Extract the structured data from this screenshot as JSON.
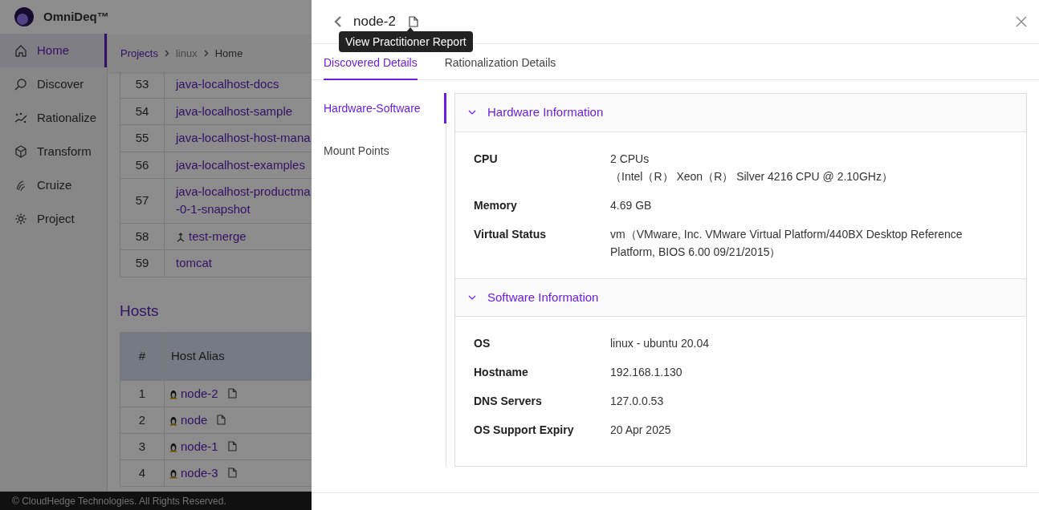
{
  "app": {
    "brand": "OmniDeq™",
    "nav": [
      {
        "label": "Home",
        "selected": true
      },
      {
        "label": "Discover",
        "selected": false
      },
      {
        "label": "Rationalize",
        "selected": false
      },
      {
        "label": "Transform",
        "selected": false
      },
      {
        "label": "Cruize",
        "selected": false
      },
      {
        "label": "Project",
        "selected": false
      }
    ],
    "breadcrumb": [
      {
        "label": "Projects",
        "kind": "link"
      },
      {
        "label": "linux",
        "kind": "muted"
      },
      {
        "label": "Home",
        "kind": "current"
      }
    ],
    "projects_table": {
      "rows": [
        {
          "number": "53",
          "name": "java-localhost-docs",
          "kind": "plain"
        },
        {
          "number": "54",
          "name": "java-localhost-sample",
          "kind": "plain"
        },
        {
          "number": "55",
          "name": "java-localhost-host-mana",
          "kind": "plain"
        },
        {
          "number": "56",
          "name": "java-localhost-examples",
          "kind": "plain"
        },
        {
          "number": "57",
          "name": "java-localhost-productma -0-1-snapshot",
          "kind": "plain"
        },
        {
          "number": "58",
          "name": "test-merge",
          "kind": "merge"
        },
        {
          "number": "59",
          "name": "tomcat",
          "kind": "plain"
        }
      ]
    },
    "hosts": {
      "heading": "Hosts",
      "columns": [
        "#",
        "Host Alias"
      ],
      "rows": [
        {
          "number": "1",
          "alias": "node-2"
        },
        {
          "number": "2",
          "alias": "node"
        },
        {
          "number": "3",
          "alias": "node-1"
        },
        {
          "number": "4",
          "alias": "node-3"
        }
      ]
    },
    "footer": "© CloudHedge Technologies. All Rights Reserved."
  },
  "drawer": {
    "title": "node-2",
    "tooltip": "View Practitioner Report",
    "tabs": [
      {
        "label": "Discovered Details",
        "selected": true
      },
      {
        "label": "Rationalization Details",
        "selected": false
      }
    ],
    "side_tabs": [
      {
        "label": "Hardware-Software",
        "selected": true
      },
      {
        "label": "Mount Points",
        "selected": false
      }
    ],
    "sections": [
      {
        "title": "Hardware Information",
        "expanded": true,
        "fields": [
          {
            "label": "CPU",
            "lines": [
              "2 CPUs",
              "（Intel（R） Xeon（R） Silver 4216 CPU @ 2.10GHz）"
            ]
          },
          {
            "label": "Memory",
            "lines": [
              "4.69 GB"
            ]
          },
          {
            "label": "Virtual Status",
            "lines": [
              "vm（VMware, Inc. VMware Virtual Platform/440BX Desktop Reference Platform, BIOS 6.00 09/21/2015）"
            ]
          }
        ]
      },
      {
        "title": "Software Information",
        "expanded": true,
        "fields": [
          {
            "label": "OS",
            "lines": [
              "linux - ubuntu 20.04"
            ]
          },
          {
            "label": "Hostname",
            "lines": [
              "192.168.1.130"
            ]
          },
          {
            "label": "DNS Servers",
            "lines": [
              "127.0.0.53"
            ]
          },
          {
            "label": "OS Support Expiry",
            "lines": [
              "20 Apr 2025"
            ]
          }
        ]
      }
    ]
  }
}
